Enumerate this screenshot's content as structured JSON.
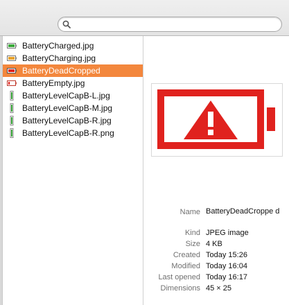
{
  "search": {
    "placeholder": "",
    "value": ""
  },
  "files": [
    {
      "name": "BatteryCharged.jpg",
      "icon": "battery-charged-icon",
      "selected": false
    },
    {
      "name": "BatteryCharging.jpg",
      "icon": "battery-charging-icon",
      "selected": false
    },
    {
      "name": "BatteryDeadCropped",
      "icon": "battery-dead-icon",
      "selected": true
    },
    {
      "name": "BatteryEmpty.jpg",
      "icon": "battery-empty-icon",
      "selected": false
    },
    {
      "name": "BatteryLevelCapB-L.jpg",
      "icon": "battery-cap-icon",
      "selected": false
    },
    {
      "name": "BatteryLevelCapB-M.jpg",
      "icon": "battery-cap-icon",
      "selected": false
    },
    {
      "name": "BatteryLevelCapB-R.jpg",
      "icon": "battery-cap-icon",
      "selected": false
    },
    {
      "name": "BatteryLevelCapB-R.png",
      "icon": "battery-cap-icon",
      "selected": false
    }
  ],
  "colors": {
    "selection": "#f3873d",
    "battery_red": "#e0221e"
  },
  "info": {
    "name_label": "Name",
    "name_value": "BatteryDeadCroppe d",
    "kind_label": "Kind",
    "kind_value": "JPEG image",
    "size_label": "Size",
    "size_value": "4 KB",
    "created_label": "Created",
    "created_value": "Today 15:26",
    "modified_label": "Modified",
    "modified_value": "Today 16:04",
    "opened_label": "Last opened",
    "opened_value": "Today 16:17",
    "dimensions_label": "Dimensions",
    "dimensions_value": "45 × 25"
  }
}
